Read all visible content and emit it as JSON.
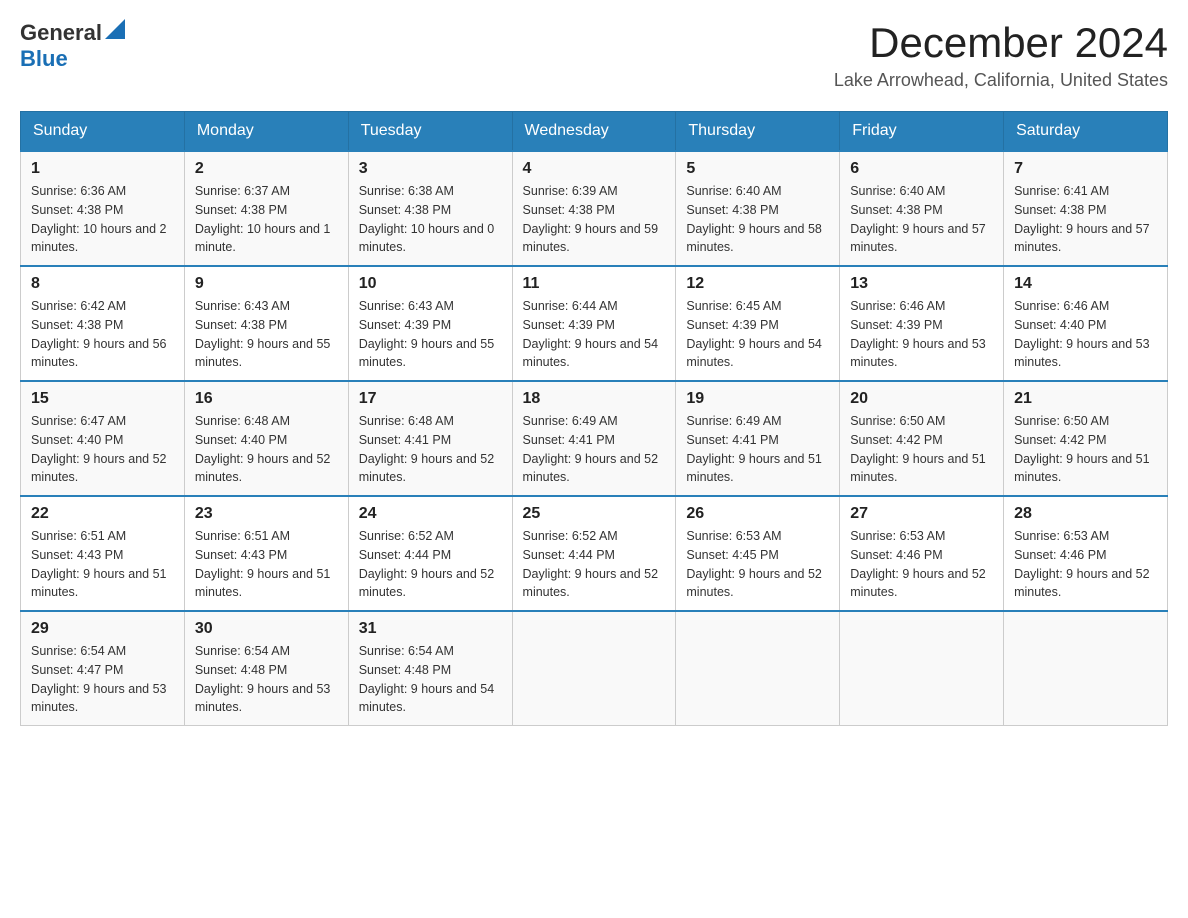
{
  "logo": {
    "general": "General",
    "blue": "Blue"
  },
  "header": {
    "month": "December 2024",
    "location": "Lake Arrowhead, California, United States"
  },
  "weekdays": [
    "Sunday",
    "Monday",
    "Tuesday",
    "Wednesday",
    "Thursday",
    "Friday",
    "Saturday"
  ],
  "weeks": [
    [
      {
        "day": "1",
        "sunrise": "6:36 AM",
        "sunset": "4:38 PM",
        "daylight": "10 hours and 2 minutes."
      },
      {
        "day": "2",
        "sunrise": "6:37 AM",
        "sunset": "4:38 PM",
        "daylight": "10 hours and 1 minute."
      },
      {
        "day": "3",
        "sunrise": "6:38 AM",
        "sunset": "4:38 PM",
        "daylight": "10 hours and 0 minutes."
      },
      {
        "day": "4",
        "sunrise": "6:39 AM",
        "sunset": "4:38 PM",
        "daylight": "9 hours and 59 minutes."
      },
      {
        "day": "5",
        "sunrise": "6:40 AM",
        "sunset": "4:38 PM",
        "daylight": "9 hours and 58 minutes."
      },
      {
        "day": "6",
        "sunrise": "6:40 AM",
        "sunset": "4:38 PM",
        "daylight": "9 hours and 57 minutes."
      },
      {
        "day": "7",
        "sunrise": "6:41 AM",
        "sunset": "4:38 PM",
        "daylight": "9 hours and 57 minutes."
      }
    ],
    [
      {
        "day": "8",
        "sunrise": "6:42 AM",
        "sunset": "4:38 PM",
        "daylight": "9 hours and 56 minutes."
      },
      {
        "day": "9",
        "sunrise": "6:43 AM",
        "sunset": "4:38 PM",
        "daylight": "9 hours and 55 minutes."
      },
      {
        "day": "10",
        "sunrise": "6:43 AM",
        "sunset": "4:39 PM",
        "daylight": "9 hours and 55 minutes."
      },
      {
        "day": "11",
        "sunrise": "6:44 AM",
        "sunset": "4:39 PM",
        "daylight": "9 hours and 54 minutes."
      },
      {
        "day": "12",
        "sunrise": "6:45 AM",
        "sunset": "4:39 PM",
        "daylight": "9 hours and 54 minutes."
      },
      {
        "day": "13",
        "sunrise": "6:46 AM",
        "sunset": "4:39 PM",
        "daylight": "9 hours and 53 minutes."
      },
      {
        "day": "14",
        "sunrise": "6:46 AM",
        "sunset": "4:40 PM",
        "daylight": "9 hours and 53 minutes."
      }
    ],
    [
      {
        "day": "15",
        "sunrise": "6:47 AM",
        "sunset": "4:40 PM",
        "daylight": "9 hours and 52 minutes."
      },
      {
        "day": "16",
        "sunrise": "6:48 AM",
        "sunset": "4:40 PM",
        "daylight": "9 hours and 52 minutes."
      },
      {
        "day": "17",
        "sunrise": "6:48 AM",
        "sunset": "4:41 PM",
        "daylight": "9 hours and 52 minutes."
      },
      {
        "day": "18",
        "sunrise": "6:49 AM",
        "sunset": "4:41 PM",
        "daylight": "9 hours and 52 minutes."
      },
      {
        "day": "19",
        "sunrise": "6:49 AM",
        "sunset": "4:41 PM",
        "daylight": "9 hours and 51 minutes."
      },
      {
        "day": "20",
        "sunrise": "6:50 AM",
        "sunset": "4:42 PM",
        "daylight": "9 hours and 51 minutes."
      },
      {
        "day": "21",
        "sunrise": "6:50 AM",
        "sunset": "4:42 PM",
        "daylight": "9 hours and 51 minutes."
      }
    ],
    [
      {
        "day": "22",
        "sunrise": "6:51 AM",
        "sunset": "4:43 PM",
        "daylight": "9 hours and 51 minutes."
      },
      {
        "day": "23",
        "sunrise": "6:51 AM",
        "sunset": "4:43 PM",
        "daylight": "9 hours and 51 minutes."
      },
      {
        "day": "24",
        "sunrise": "6:52 AM",
        "sunset": "4:44 PM",
        "daylight": "9 hours and 52 minutes."
      },
      {
        "day": "25",
        "sunrise": "6:52 AM",
        "sunset": "4:44 PM",
        "daylight": "9 hours and 52 minutes."
      },
      {
        "day": "26",
        "sunrise": "6:53 AM",
        "sunset": "4:45 PM",
        "daylight": "9 hours and 52 minutes."
      },
      {
        "day": "27",
        "sunrise": "6:53 AM",
        "sunset": "4:46 PM",
        "daylight": "9 hours and 52 minutes."
      },
      {
        "day": "28",
        "sunrise": "6:53 AM",
        "sunset": "4:46 PM",
        "daylight": "9 hours and 52 minutes."
      }
    ],
    [
      {
        "day": "29",
        "sunrise": "6:54 AM",
        "sunset": "4:47 PM",
        "daylight": "9 hours and 53 minutes."
      },
      {
        "day": "30",
        "sunrise": "6:54 AM",
        "sunset": "4:48 PM",
        "daylight": "9 hours and 53 minutes."
      },
      {
        "day": "31",
        "sunrise": "6:54 AM",
        "sunset": "4:48 PM",
        "daylight": "9 hours and 54 minutes."
      },
      null,
      null,
      null,
      null
    ]
  ]
}
